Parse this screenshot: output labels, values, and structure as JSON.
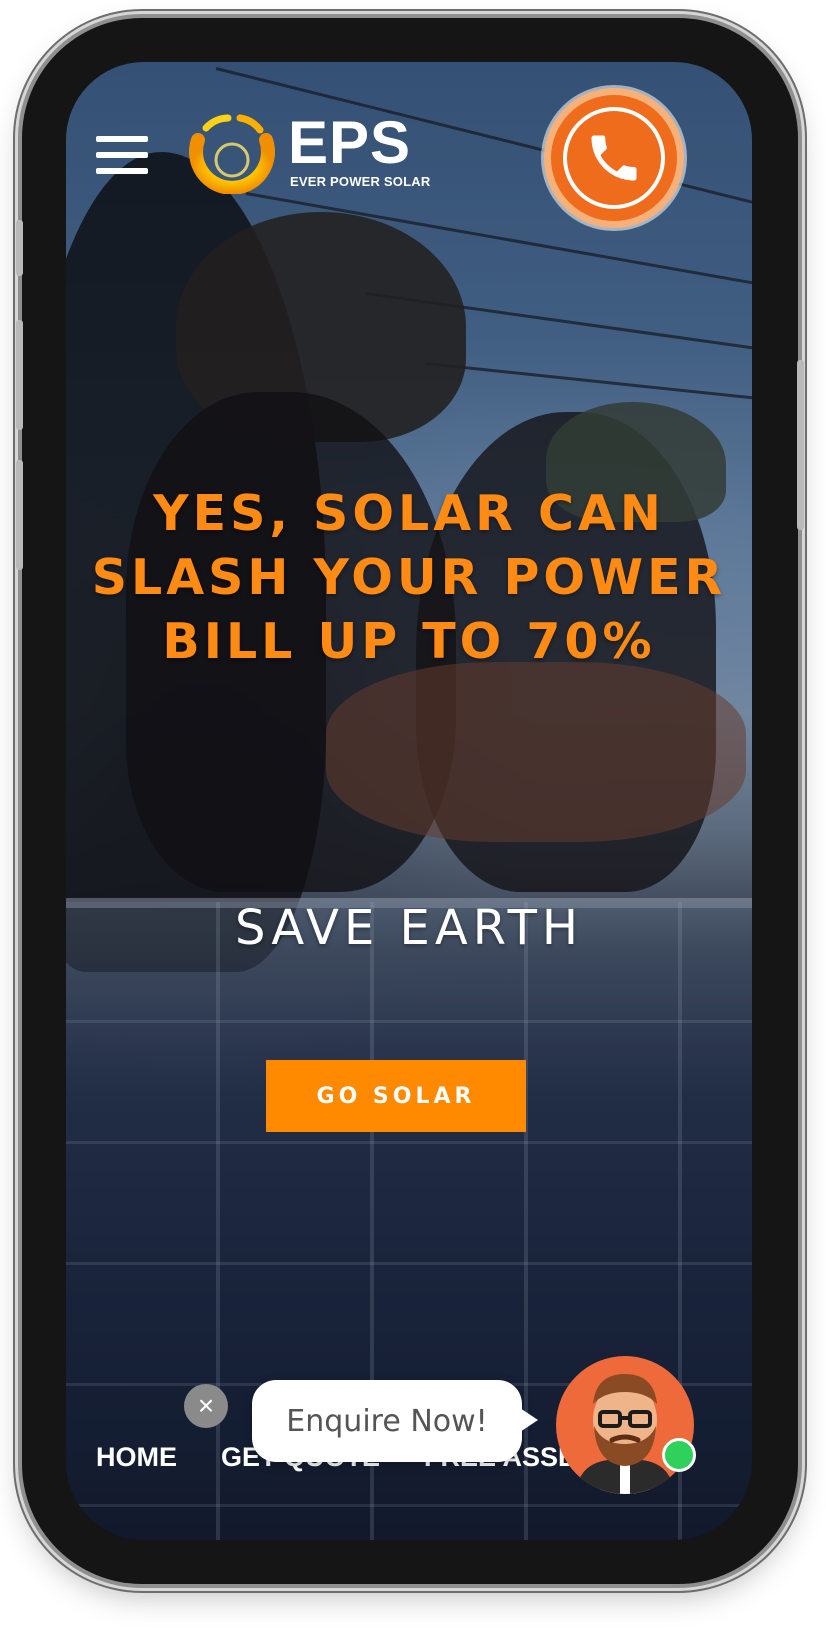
{
  "header": {
    "menu_icon": "hamburger-icon",
    "logo": {
      "name": "EPS",
      "subtitle": "EVER POWER SOLAR"
    },
    "call_icon": "phone-icon"
  },
  "hero": {
    "headline": "YES, SOLAR CAN SLASH YOUR POWER BILL UP TO 70%",
    "tagline": "SAVE EARTH",
    "cta_label": "GO SOLAR"
  },
  "bottom_nav": {
    "items": [
      {
        "label": "HOME"
      },
      {
        "label": "GET QUOTE"
      },
      {
        "label": "FREE ASSESSMENT"
      }
    ]
  },
  "chat_widget": {
    "close_glyph": "×",
    "message": "Enquire Now!",
    "avatar_icon": "bearded-man-avatar",
    "status_color": "#2fd15a"
  },
  "colors": {
    "accent": "#ff8a00",
    "headline": "#ff8a14",
    "call_button": "#ef6c1c"
  }
}
